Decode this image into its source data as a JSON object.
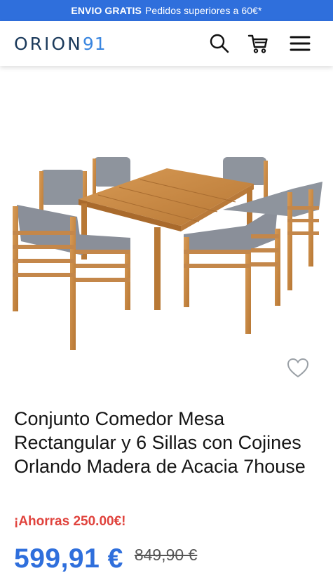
{
  "promo": {
    "strong": "ENVIO GRATIS",
    "text": "Pedidos superiores a 60€*"
  },
  "header": {
    "logo_text": "ORION",
    "logo_number": "91",
    "icons": [
      "search-icon",
      "cart-icon",
      "hamburger-menu-icon"
    ]
  },
  "product": {
    "title": "Conjunto Comedor Mesa Rectangular y 6 Sillas con Cojines Orlando Madera de Acacia 7house",
    "savings": "¡Ahorras 250.00€!",
    "price": "599,91 €",
    "old_price": "849,90 €",
    "favorite_icon": "heart-outline-icon"
  },
  "colors": {
    "promo_bg": "#2f6fdc",
    "price": "#2f6fdc",
    "savings": "#e0433d",
    "logo_dark": "#1b3a5b",
    "logo_accent": "#3a86e0",
    "wood": "#c98a45",
    "cushion": "#8a8f99"
  }
}
